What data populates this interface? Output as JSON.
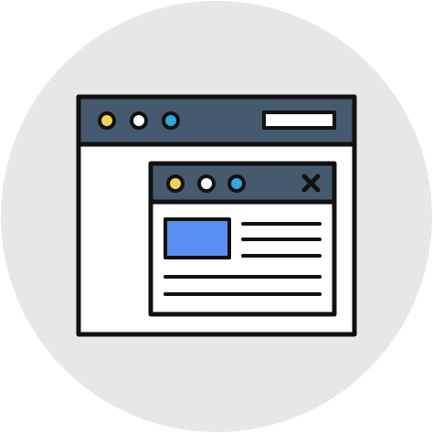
{
  "icon": {
    "name": "browser-popup-window-icon",
    "colors": {
      "background_circle": "#e6e7e8",
      "outline": "#111111",
      "title_bar": "#455a6e",
      "window_body": "#ffffff",
      "dot_yellow": "#f3cf5b",
      "dot_white": "#ffffff",
      "dot_blue": "#33a5e0",
      "address_bar": "#ffffff",
      "image_placeholder": "#5b8ef2",
      "text_lines": "#111111"
    },
    "main_window": {
      "dots": [
        "yellow",
        "white",
        "blue"
      ],
      "has_address_bar": true
    },
    "popup_window": {
      "dots": [
        "yellow",
        "white",
        "blue"
      ],
      "has_close_icon": true,
      "content_lines_beside_image": 3,
      "content_lines_below_image": 2
    }
  }
}
